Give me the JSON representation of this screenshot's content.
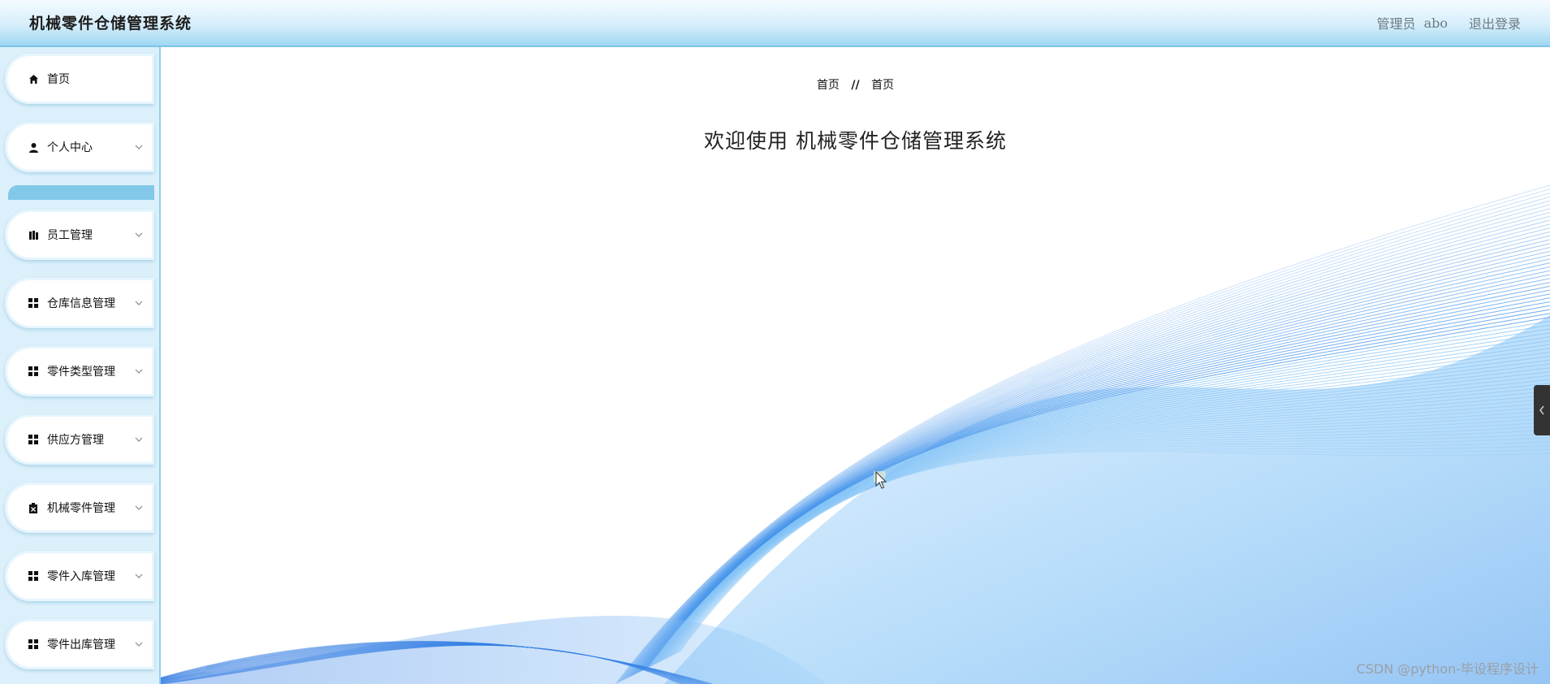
{
  "header": {
    "title": "机械零件仓储管理系统",
    "role_label": "管理员",
    "username": "abo",
    "logout_label": "退出登录"
  },
  "sidebar": {
    "items": [
      {
        "label": "首页",
        "icon": "home-icon",
        "expandable": false
      },
      {
        "label": "个人中心",
        "icon": "user-icon",
        "expandable": true
      },
      {
        "label": "员工管理",
        "icon": "book-icon",
        "expandable": true
      },
      {
        "label": "仓库信息管理",
        "icon": "grid-icon",
        "expandable": true
      },
      {
        "label": "零件类型管理",
        "icon": "grid-icon",
        "expandable": true
      },
      {
        "label": "供应方管理",
        "icon": "grid-icon",
        "expandable": true
      },
      {
        "label": "机械零件管理",
        "icon": "clipboard-icon",
        "expandable": true
      },
      {
        "label": "零件入库管理",
        "icon": "grid-icon",
        "expandable": true
      },
      {
        "label": "零件出库管理",
        "icon": "grid-icon",
        "expandable": true
      }
    ]
  },
  "breadcrumb": {
    "root": "首页",
    "separator": "//",
    "current": "首页"
  },
  "main": {
    "welcome": "欢迎使用 机械零件仓储管理系统"
  },
  "watermark": "CSDN @python-毕设程序设计",
  "colors": {
    "header_gradient_bottom": "#9fd8f2",
    "sidebar_bg": "#dcf0fb",
    "wave_blue": "#2f8fe8"
  }
}
